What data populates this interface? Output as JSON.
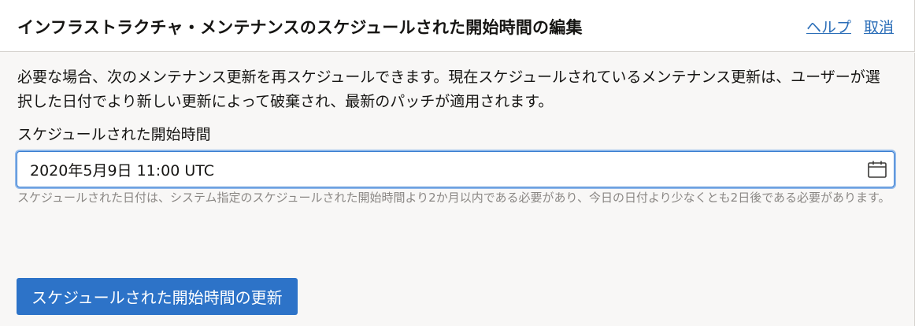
{
  "header": {
    "title": "インフラストラクチャ・メンテナンスのスケジュールされた開始時間の編集",
    "help_label": "ヘルプ",
    "cancel_label": "取消"
  },
  "main": {
    "description": "必要な場合、次のメンテナンス更新を再スケジュールできます。現在スケジュールされているメンテナンス更新は、ユーザーが選択した日付でより新しい更新によって破棄され、最新のパッチが適用されます。",
    "field_label": "スケジュールされた開始時間",
    "date_value": "2020年5月9日 11:00 UTC",
    "calendar_icon": "calendar-icon",
    "hint": "スケジュールされた日付は、システム指定のスケジュールされた開始時間より2か月以内である必要があり、今日の日付より少なくとも2日後である必要があります。",
    "submit_label": "スケジュールされた開始時間の更新"
  },
  "colors": {
    "link": "#2b6eb8",
    "primary_button": "#2d73c8",
    "focus_border": "#3a7dd0",
    "hint_text": "#8a8784"
  }
}
